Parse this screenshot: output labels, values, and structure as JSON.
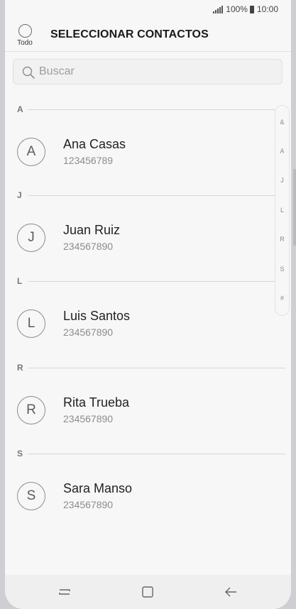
{
  "status_bar": {
    "battery": "100%",
    "time": "10:00"
  },
  "header": {
    "select_all_label": "Todo",
    "title": "SELECCIONAR CONTACTOS"
  },
  "search": {
    "placeholder": "Buscar"
  },
  "sections": [
    {
      "letter": "A",
      "contacts": [
        {
          "initial": "A",
          "name": "Ana Casas",
          "number": "123456789"
        }
      ]
    },
    {
      "letter": "J",
      "contacts": [
        {
          "initial": "J",
          "name": "Juan Ruiz",
          "number": "234567890"
        }
      ]
    },
    {
      "letter": "L",
      "contacts": [
        {
          "initial": "L",
          "name": "Luis Santos",
          "number": "234567890"
        }
      ]
    },
    {
      "letter": "R",
      "contacts": [
        {
          "initial": "R",
          "name": "Rita Trueba",
          "number": "234567890"
        }
      ]
    },
    {
      "letter": "S",
      "contacts": [
        {
          "initial": "S",
          "name": "Sara Manso",
          "number": "234567890"
        }
      ]
    }
  ],
  "index": [
    "&",
    "A",
    "J",
    "L",
    "R",
    "S",
    "#"
  ],
  "nav": {
    "recents_icon": "recents-icon",
    "home_icon": "home-icon",
    "back_icon": "back-icon"
  }
}
